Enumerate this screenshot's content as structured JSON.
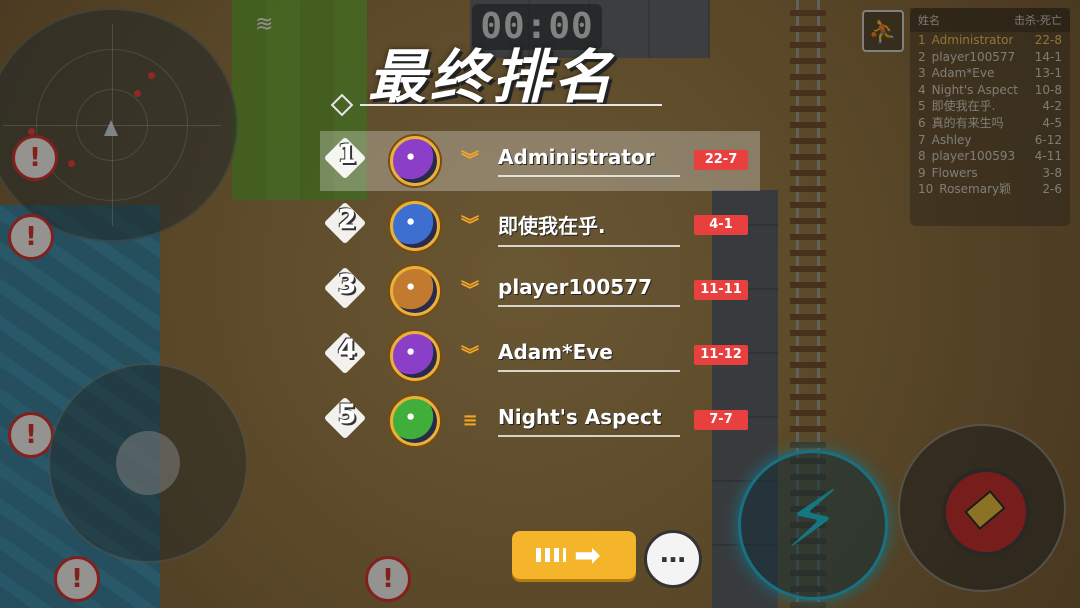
{
  "hud": {
    "timer": "00:00",
    "spectate_icon": "walking-person-icon",
    "mini_scoreboard": {
      "col_name": "姓名",
      "col_score": "击杀-死亡",
      "rows": [
        {
          "rank": "1",
          "name": "Administrator",
          "score": "22-8"
        },
        {
          "rank": "2",
          "name": "player100577",
          "score": "14-1"
        },
        {
          "rank": "3",
          "name": "Adam*Eve",
          "score": "13-1"
        },
        {
          "rank": "4",
          "name": "Night's Aspect",
          "score": "10-8"
        },
        {
          "rank": "5",
          "name": "即使我在乎.",
          "score": "4-2"
        },
        {
          "rank": "6",
          "name": "真的有来生吗",
          "score": "4-5"
        },
        {
          "rank": "7",
          "name": "Ashley",
          "score": "6-12"
        },
        {
          "rank": "8",
          "name": "player100593",
          "score": "4-11"
        },
        {
          "rank": "9",
          "name": "Flowers",
          "score": "3-8"
        },
        {
          "rank": "10",
          "name": "Rosemary颖",
          "score": "2-6"
        }
      ]
    },
    "alert_glyph": "!",
    "skill_glyph": "⚡"
  },
  "ranking": {
    "title": "最终排名",
    "players": [
      {
        "rank": "1",
        "name": "Administrator",
        "score": "22-7",
        "rank_icon": "chevron",
        "avatar_color": "#8b3fc8"
      },
      {
        "rank": "2",
        "name": "即使我在乎.",
        "score": "4-1",
        "rank_icon": "chevron",
        "avatar_color": "#3d6fd0"
      },
      {
        "rank": "3",
        "name": "player100577",
        "score": "11-11",
        "rank_icon": "chevron",
        "avatar_color": "#c27a2e"
      },
      {
        "rank": "4",
        "name": "Adam*Eve",
        "score": "11-12",
        "rank_icon": "chevron",
        "avatar_color": "#8b3fc8"
      },
      {
        "rank": "5",
        "name": "Night's Aspect",
        "score": "7-7",
        "rank_icon": "bars",
        "avatar_color": "#3fae3a"
      }
    ]
  },
  "buttons": {
    "next_icon": "next-arrow-icon",
    "chat_glyph": "…"
  }
}
